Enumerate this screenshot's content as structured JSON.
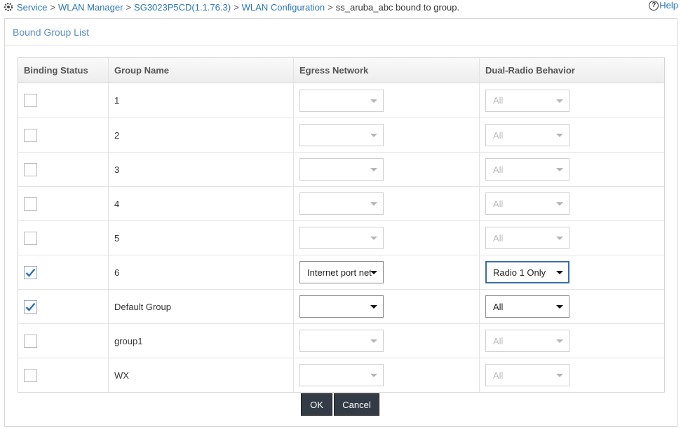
{
  "breadcrumb": {
    "icon": "gear-icon",
    "items": [
      "Service",
      "WLAN Manager",
      "SG3023P5CD(1.1.76.3)",
      "WLAN Configuration"
    ],
    "separator": ">",
    "current": "ss_aruba_abc bound to group."
  },
  "help": {
    "icon": "question-circle-icon",
    "label": "Help"
  },
  "panel": {
    "title": "Bound Group List"
  },
  "table": {
    "columns": [
      "Binding Status",
      "Group Name",
      "Egress Network",
      "Dual-Radio Behavior"
    ],
    "rows": [
      {
        "checked": false,
        "group": "1",
        "egress": "",
        "radio": "All",
        "enabled": false
      },
      {
        "checked": false,
        "group": "2",
        "egress": "",
        "radio": "All",
        "enabled": false
      },
      {
        "checked": false,
        "group": "3",
        "egress": "",
        "radio": "All",
        "enabled": false
      },
      {
        "checked": false,
        "group": "4",
        "egress": "",
        "radio": "All",
        "enabled": false
      },
      {
        "checked": false,
        "group": "5",
        "egress": "",
        "radio": "All",
        "enabled": false
      },
      {
        "checked": true,
        "group": "6",
        "egress": "Internet port net",
        "radio": "Radio 1 Only",
        "enabled": true,
        "radio_focused": true
      },
      {
        "checked": true,
        "group": "Default Group",
        "egress": "",
        "radio": "All",
        "enabled": true
      },
      {
        "checked": false,
        "group": "group1",
        "egress": "",
        "radio": "All",
        "enabled": false
      },
      {
        "checked": false,
        "group": "WX",
        "egress": "",
        "radio": "All",
        "enabled": false
      }
    ]
  },
  "buttons": {
    "ok": "OK",
    "cancel": "Cancel"
  },
  "colors": {
    "link": "#2a76b8",
    "panel_title": "#5b8fc7",
    "button_bg": "#333c46",
    "check": "#2a6fb5"
  }
}
